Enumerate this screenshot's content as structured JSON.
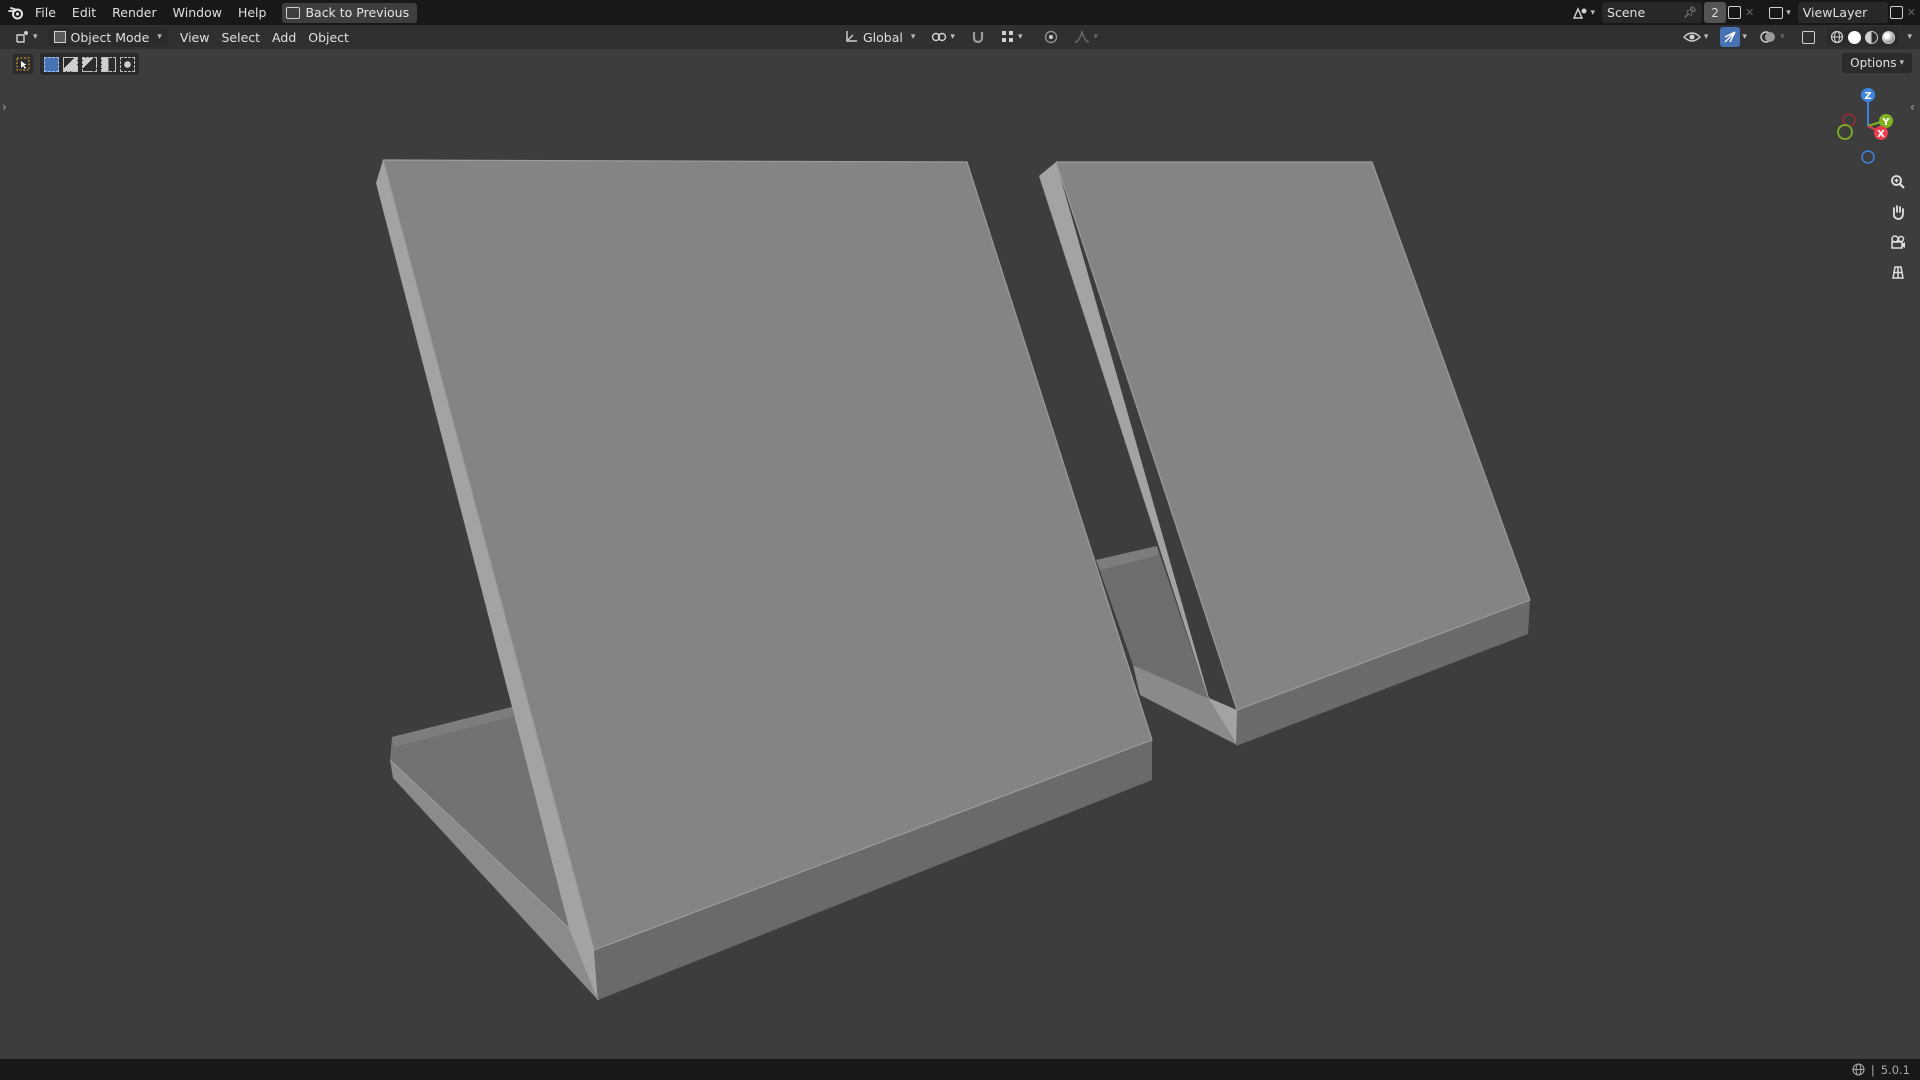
{
  "menu": {
    "file": "File",
    "edit": "Edit",
    "render": "Render",
    "window": "Window",
    "help": "Help",
    "back_button": "Back to Previous"
  },
  "scene": {
    "name": "Scene",
    "user_count": "2",
    "view_layer": "ViewLayer"
  },
  "header": {
    "mode": "Object Mode",
    "view": "View",
    "select": "Select",
    "add": "Add",
    "object": "Object",
    "transform_orientation": "Global",
    "options": "Options"
  },
  "gizmo": {
    "z_label": "Z",
    "y_label": "Y",
    "x_label": "X"
  },
  "status": {
    "version": "5.0.1"
  },
  "colors": {
    "accent": "#4772b3",
    "axis_x": "#e8404f",
    "axis_y": "#7fb31f",
    "axis_z": "#3c84e0",
    "background": "#3d3d3d"
  },
  "icons": {
    "blender_logo": "blender-logo-icon",
    "zoom": "zoom-icon",
    "pan": "hand-pan-icon",
    "camera": "camera-view-icon",
    "grid": "orthographic-grid-icon"
  }
}
